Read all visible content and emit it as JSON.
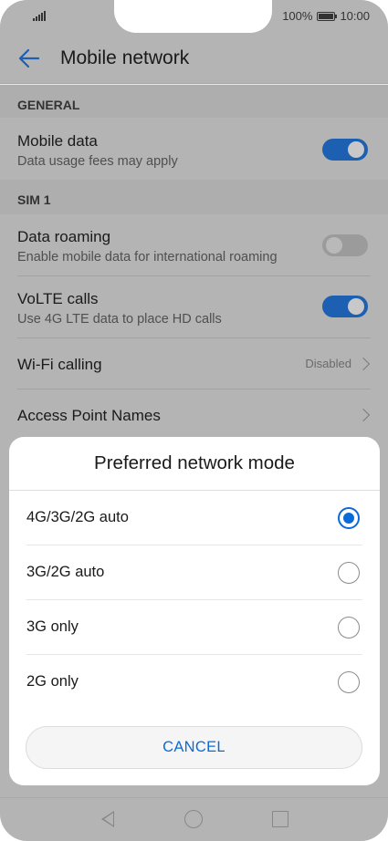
{
  "status": {
    "battery": "100%",
    "time": "10:00"
  },
  "header": {
    "title": "Mobile network"
  },
  "sections": {
    "general": "GENERAL",
    "sim1": "SIM 1"
  },
  "settings": {
    "mobile_data": {
      "title": "Mobile data",
      "subtitle": "Data usage fees may apply",
      "enabled": true
    },
    "data_roaming": {
      "title": "Data roaming",
      "subtitle": "Enable mobile data for international roaming",
      "enabled": false
    },
    "volte": {
      "title": "VoLTE calls",
      "subtitle": "Use 4G LTE data to place HD calls",
      "enabled": true
    },
    "wifi_calling": {
      "title": "Wi-Fi calling",
      "value": "Disabled"
    },
    "apn": {
      "title": "Access Point Names"
    }
  },
  "dialog": {
    "title": "Preferred network mode",
    "options": [
      {
        "label": "4G/3G/2G auto",
        "selected": true
      },
      {
        "label": "3G/2G auto",
        "selected": false
      },
      {
        "label": "3G only",
        "selected": false
      },
      {
        "label": "2G only",
        "selected": false
      }
    ],
    "cancel_label": "CANCEL"
  },
  "colors": {
    "accent": "#0a6bd8",
    "toggle_on": "#1d5fb0",
    "dim_background": "#b4b4b4"
  },
  "icons": {
    "back": "arrow-left-icon",
    "nav_back": "triangle-back-icon",
    "nav_home": "circle-home-icon",
    "nav_recent": "square-recents-icon"
  }
}
